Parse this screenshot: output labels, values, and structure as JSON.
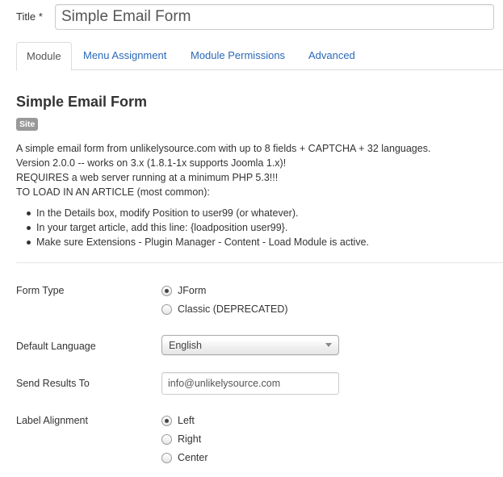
{
  "title_field": {
    "label": "Title *",
    "value": "Simple Email Form"
  },
  "tabs": [
    {
      "label": "Module",
      "active": true
    },
    {
      "label": "Menu Assignment",
      "active": false
    },
    {
      "label": "Module Permissions",
      "active": false
    },
    {
      "label": "Advanced",
      "active": false
    }
  ],
  "module": {
    "heading": "Simple Email Form",
    "badge": "Site",
    "description": [
      "A simple email form from unlikelysource.com with up to 8 fields + CAPTCHA + 32 languages.",
      "Version 2.0.0 -- works on 3.x (1.8.1-1x supports Joomla 1.x)!",
      "REQUIRES a web server running at a minimum PHP 5.3!!!",
      "TO LOAD IN AN ARTICLE (most common):"
    ],
    "bullets": [
      "In the Details box, modify Position to user99 (or whatever).",
      "In your target article, add this line: {loadposition user99}.",
      "Make sure Extensions - Plugin Manager - Content - Load Module is active."
    ]
  },
  "form": {
    "form_type": {
      "label": "Form Type",
      "options": [
        {
          "label": "JForm",
          "checked": true
        },
        {
          "label": "Classic (DEPRECATED)",
          "checked": false
        }
      ]
    },
    "default_language": {
      "label": "Default Language",
      "value": "English"
    },
    "send_results_to": {
      "label": "Send Results To",
      "value": "info@unlikelysource.com"
    },
    "label_alignment": {
      "label": "Label Alignment",
      "options": [
        {
          "label": "Left",
          "checked": true
        },
        {
          "label": "Right",
          "checked": false
        },
        {
          "label": "Center",
          "checked": false
        }
      ]
    }
  }
}
